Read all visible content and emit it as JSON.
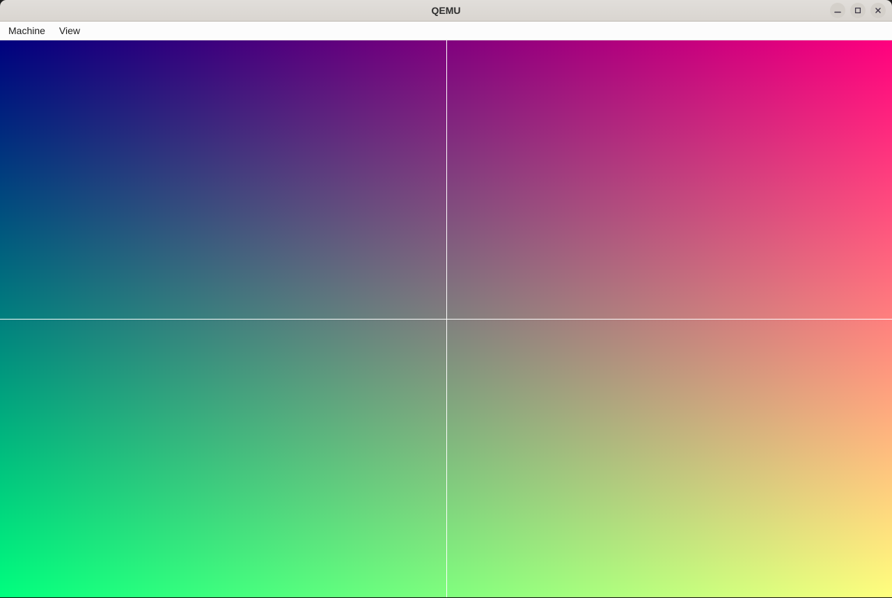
{
  "window": {
    "title": "QEMU",
    "controls": [
      {
        "name": "minimize",
        "icon": "minimize-icon"
      },
      {
        "name": "maximize",
        "icon": "maximize-icon"
      },
      {
        "name": "close",
        "icon": "close-icon"
      }
    ]
  },
  "menubar": {
    "items": [
      {
        "label": "Machine"
      },
      {
        "label": "View"
      }
    ]
  },
  "display": {
    "gradient": {
      "top_left": "#00007e",
      "top_right": "#ff007e",
      "bottom_left": "#00ff7e",
      "bottom_right": "#ffff7e",
      "green_ramp_end": "#00ff00"
    },
    "crosshair": {
      "color": "#ffffff",
      "vertical_x_percent": 50,
      "horizontal_y_percent": 50
    }
  },
  "theme": {
    "titlebar_bg": "#e1deda",
    "titlebar_text": "#2e2e2e",
    "menubar_bg": "#fcfcfc",
    "menu_text": "#1a1a1a",
    "control_button_bg": "#d4d0ca",
    "control_glyph": "#3d3846"
  }
}
